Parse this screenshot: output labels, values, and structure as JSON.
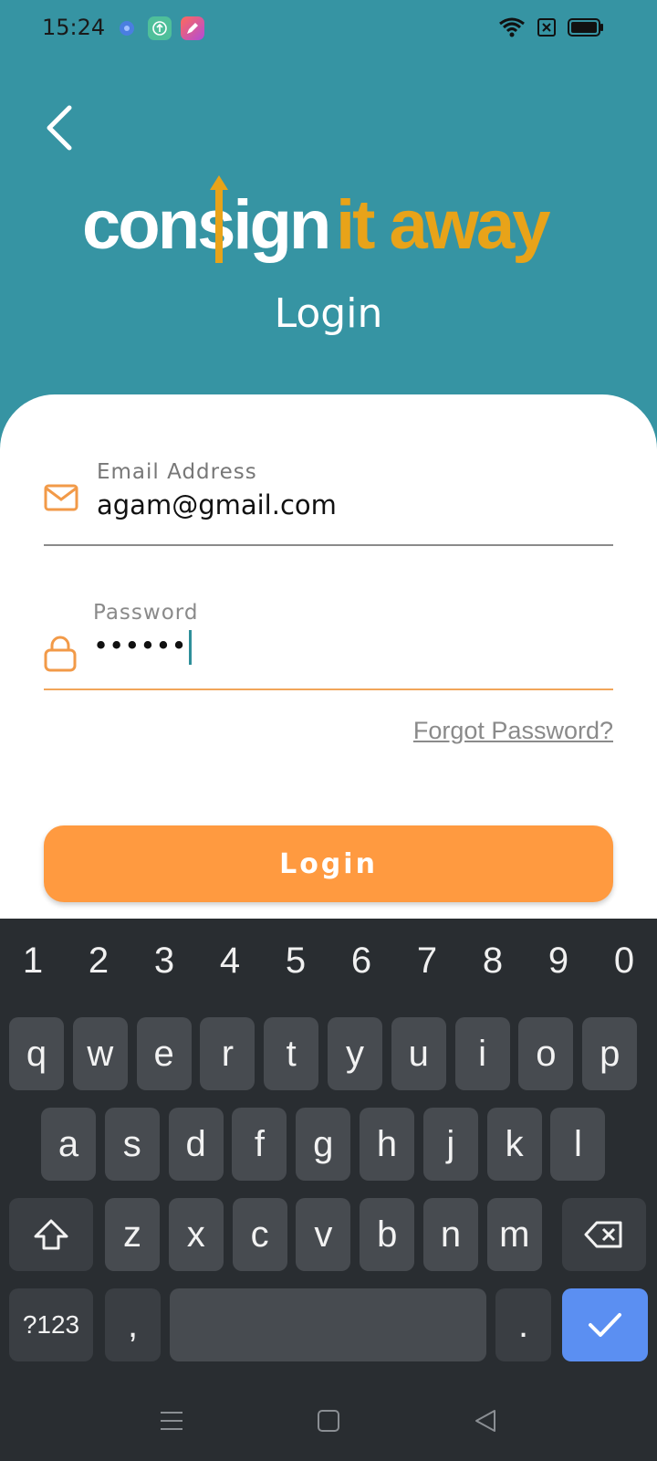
{
  "status_bar": {
    "time": "15:24",
    "left_icons": [
      "settings-app-icon",
      "upload-app-icon",
      "pen-app-icon"
    ],
    "right_icons": [
      "wifi-icon",
      "no-sim-icon",
      "battery-icon"
    ]
  },
  "header": {
    "back_icon": "chevron-left-icon",
    "logo_part1": "consign",
    "logo_part2": "it away",
    "title": "Login"
  },
  "form": {
    "email": {
      "label": "Email Address",
      "value": "agam@gmail.com",
      "icon": "mail-icon"
    },
    "password": {
      "label": "Password",
      "value": "••••••",
      "icon": "lock-icon"
    },
    "forgot_label": "Forgot Password?",
    "login_label": "Login"
  },
  "keyboard": {
    "numbers": [
      "1",
      "2",
      "3",
      "4",
      "5",
      "6",
      "7",
      "8",
      "9",
      "0"
    ],
    "row1": [
      "q",
      "w",
      "e",
      "r",
      "t",
      "y",
      "u",
      "i",
      "o",
      "p"
    ],
    "row2": [
      "a",
      "s",
      "d",
      "f",
      "g",
      "h",
      "j",
      "k",
      "l"
    ],
    "row3": [
      "z",
      "x",
      "c",
      "v",
      "b",
      "n",
      "m"
    ],
    "symbols_label": "?123",
    "comma": ",",
    "period": "."
  },
  "colors": {
    "teal": "#3694a3",
    "accent": "#ff9a40",
    "logo_orange": "#e8a319",
    "keyboard_bg": "#292d31",
    "done_key": "#5b8ff2"
  }
}
